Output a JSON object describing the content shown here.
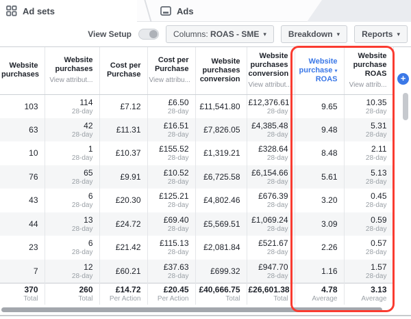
{
  "tabs": [
    {
      "label": "Ad sets",
      "icon": "grid-icon"
    },
    {
      "label": "Ads",
      "icon": "ad-box-icon"
    }
  ],
  "toolbar": {
    "view_setup_label": "View Setup",
    "view_setup_state": "off",
    "columns_prefix": "Columns:",
    "columns_value": "ROAS - SME",
    "breakdown_label": "Breakdown",
    "reports_label": "Reports"
  },
  "icons": {
    "chevron_down": "▾",
    "plus": "+",
    "sort_descending": "▾"
  },
  "table": {
    "attribution_window": "28-day",
    "columns": [
      {
        "title": "Website purchases",
        "sub": "",
        "attribution": false,
        "sorted": false,
        "highlighted": false
      },
      {
        "title": "Website purchases",
        "sub": "View attribut...",
        "attribution": true,
        "sorted": false,
        "highlighted": false
      },
      {
        "title": "Cost per Purchase",
        "sub": "",
        "attribution": false,
        "sorted": false,
        "highlighted": false
      },
      {
        "title": "Cost per Purchase",
        "sub": "View attribu...",
        "attribution": true,
        "sorted": false,
        "highlighted": false
      },
      {
        "title": "Website purchases conversion",
        "sub": "",
        "attribution": false,
        "sorted": false,
        "highlighted": false
      },
      {
        "title": "Website purchases conversion",
        "sub": "View attribut...",
        "attribution": true,
        "sorted": false,
        "highlighted": false
      },
      {
        "title": "Website purchase",
        "title_line2": "ROAS",
        "sub": "",
        "attribution": false,
        "sorted": true,
        "highlighted": true
      },
      {
        "title": "Website purchase ROAS",
        "sub": "View attrib...",
        "attribution": true,
        "sorted": false,
        "highlighted": true
      }
    ],
    "rows": [
      [
        "103",
        "114",
        "£7.12",
        "£6.50",
        "£11,541.80",
        "£12,376.61",
        "9.65",
        "10.35"
      ],
      [
        "63",
        "42",
        "£11.31",
        "£16.51",
        "£7,826.05",
        "£4,385.48",
        "9.48",
        "5.31"
      ],
      [
        "10",
        "1",
        "£10.37",
        "£155.52",
        "£1,319.21",
        "£328.64",
        "8.48",
        "2.11"
      ],
      [
        "76",
        "65",
        "£9.91",
        "£10.52",
        "£6,725.58",
        "£6,154.66",
        "5.61",
        "5.13"
      ],
      [
        "43",
        "6",
        "£20.30",
        "£125.21",
        "£4,802.46",
        "£676.39",
        "3.20",
        "0.45"
      ],
      [
        "44",
        "13",
        "£24.72",
        "£69.40",
        "£5,569.51",
        "£1,069.24",
        "3.09",
        "0.59"
      ],
      [
        "23",
        "6",
        "£21.42",
        "£115.13",
        "£2,081.84",
        "£521.67",
        "2.26",
        "0.57"
      ],
      [
        "7",
        "12",
        "£60.21",
        "£37.63",
        "£699.32",
        "£947.70",
        "1.16",
        "1.57"
      ]
    ],
    "summary": {
      "values": [
        "370",
        "260",
        "£14.72",
        "£20.45",
        "£40,666.75",
        "£26,601.38",
        "4.78",
        "3.13"
      ],
      "labels": [
        "Total",
        "Total",
        "Per Action",
        "Per Action",
        "Total",
        "Total",
        "Average",
        "Average"
      ]
    }
  },
  "colors": {
    "accent_blue": "#3b78e7",
    "highlight_red": "#fa3b30",
    "header_text": "#1d2129",
    "secondary_text": "#90949c",
    "row_stripe": "#f5f6f7"
  }
}
